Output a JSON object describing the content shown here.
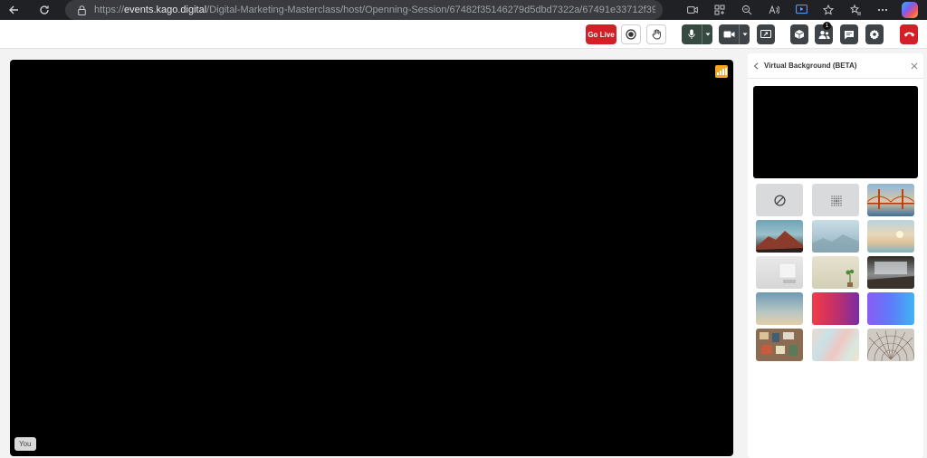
{
  "browser": {
    "url_scheme": "https://",
    "url_host": "events.kago.digital",
    "url_path": "/Digital-Marketing-Masterclass/host/Openning-Session/67482f35146279d5dbd7322a/67491e33712f39d..."
  },
  "toolbar": {
    "go_live_label": "Go Live",
    "participants_count": "1"
  },
  "stage": {
    "you_label": "You"
  },
  "panel": {
    "title": "Virtual Background (BETA)",
    "tiles": [
      {
        "name": "none",
        "kind": "none-icon"
      },
      {
        "name": "blur",
        "kind": "blur-icon"
      },
      {
        "name": "golden-gate-bridge",
        "kind": "image"
      },
      {
        "name": "red-mountains",
        "kind": "image"
      },
      {
        "name": "misty-mountains",
        "kind": "image"
      },
      {
        "name": "sunset-beach",
        "kind": "image"
      },
      {
        "name": "white-room",
        "kind": "image"
      },
      {
        "name": "plant-wall",
        "kind": "image"
      },
      {
        "name": "dark-office",
        "kind": "image"
      },
      {
        "name": "sky-gradient",
        "kind": "image"
      },
      {
        "name": "red-purple-gradient",
        "kind": "image"
      },
      {
        "name": "purple-blue-gradient",
        "kind": "image"
      },
      {
        "name": "shelf-wall",
        "kind": "image"
      },
      {
        "name": "pastel-abstract",
        "kind": "image"
      },
      {
        "name": "mandala-pattern",
        "kind": "image"
      }
    ]
  },
  "colors": {
    "accent_red": "#d32027",
    "signal_orange": "#f5a623",
    "dark_button": "#3d4347"
  }
}
